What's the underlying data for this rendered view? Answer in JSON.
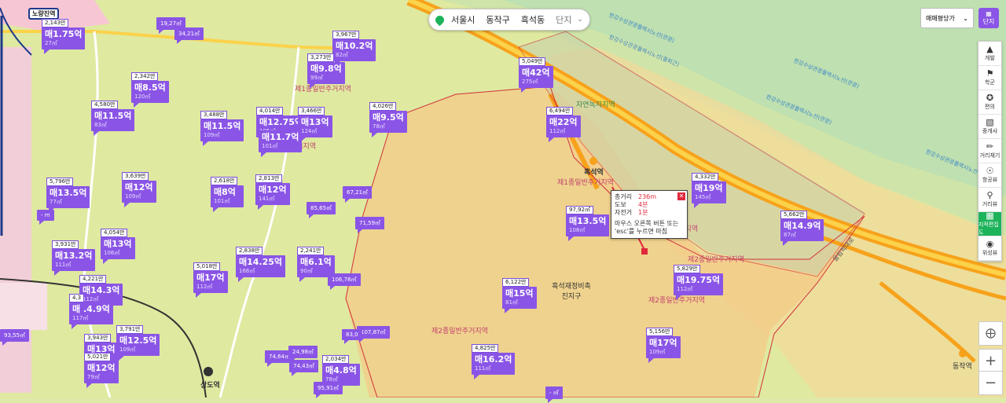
{
  "search_bar": {
    "city": "서울시",
    "district": "동작구",
    "dong": "흑석동",
    "mode": "단지"
  },
  "controls": {
    "select_label": "매매평당가",
    "danji_label": "단지",
    "tools": [
      {
        "label": "개발",
        "icon": "development-icon"
      },
      {
        "label": "학군",
        "icon": "school-icon"
      },
      {
        "label": "편의",
        "icon": "convenience-icon"
      },
      {
        "label": "중개사",
        "icon": "agent-icon"
      },
      {
        "label": "거리재기",
        "icon": "ruler-icon"
      },
      {
        "label": "항공뷰",
        "icon": "aerial-icon"
      },
      {
        "label": "거리뷰",
        "icon": "streetview-icon"
      },
      {
        "label": "지적편집도",
        "icon": "cadastral-icon"
      },
      {
        "label": "위성뷰",
        "icon": "satellite-icon"
      }
    ]
  },
  "popup": {
    "rows": [
      {
        "k": "총거리",
        "v": "236m"
      },
      {
        "k": "도보",
        "v": "4분"
      },
      {
        "k": "자전거",
        "v": "1분"
      }
    ],
    "note": "마우스 오른쪽 버튼 또는 'esc'를 누르면 마침",
    "close": "✕"
  },
  "markers": [
    {
      "tag": "2,143만",
      "price": "매1.75억",
      "area": "27㎡"
    },
    {
      "tag": "3,967만",
      "price": "매10.2억",
      "area": "82㎡"
    },
    {
      "tag": "3,273만",
      "price": "매9.8억",
      "area": "99㎡"
    },
    {
      "tag": "5,049만",
      "price": "매42억",
      "area": "275㎡"
    },
    {
      "tag": "2,342만",
      "price": "매8.5억",
      "area": "120㎡"
    },
    {
      "tag": "4,580만",
      "price": "매11.5억",
      "area": "83㎡"
    },
    {
      "tag": "3,488만",
      "price": "매11.5억",
      "area": "109㎡"
    },
    {
      "tag": "4,014만",
      "price": "매12.75억",
      "area": "105㎡"
    },
    {
      "tag": "3,466만",
      "price": "매13억",
      "area": "124㎡"
    },
    {
      "tag": "4,026만",
      "price": "매9.5억",
      "area": "78㎡"
    },
    {
      "tag": "6,494만",
      "price": "매22억",
      "area": "112㎡"
    },
    {
      "tag": "",
      "price": "매11.7억",
      "area": "101㎡"
    },
    {
      "tag": "5,796만",
      "price": "매13.5억",
      "area": "77㎡"
    },
    {
      "tag": "3,639만",
      "price": "매12억",
      "area": "109㎡"
    },
    {
      "tag": "2,618만",
      "price": "매8억",
      "area": "101㎡"
    },
    {
      "tag": "2,813만",
      "price": "매12억",
      "area": "141㎡"
    },
    {
      "tag": "4,332만",
      "price": "매19억",
      "area": "145㎡"
    },
    {
      "tag": "97,92㎡",
      "price": "매13.5억",
      "area": "108㎡"
    },
    {
      "tag": "5,662만",
      "price": "매14.9억",
      "area": "87㎡"
    },
    {
      "tag": "3,931만",
      "price": "매13.2억",
      "area": "111㎡"
    },
    {
      "tag": "4,054만",
      "price": "매13억",
      "area": "106㎡"
    },
    {
      "tag": "2,838만",
      "price": "매14.25억",
      "area": "166㎡"
    },
    {
      "tag": "2,241만",
      "price": "매6.1억",
      "area": "90㎡"
    },
    {
      "tag": "5,018만",
      "price": "매17억",
      "area": "112㎡"
    },
    {
      "tag": "5,829만",
      "price": "매19.75억",
      "area": "112㎡"
    },
    {
      "tag": "4,221만",
      "price": "매14.3억",
      "area": "112㎡"
    },
    {
      "tag": "4,3",
      "price": "매 .4.9억",
      "area": "117㎡"
    },
    {
      "tag": "6,122만",
      "price": "매15억",
      "area": "81㎡"
    },
    {
      "tag": "3,791만",
      "price": "매12.5억",
      "area": "109㎡"
    },
    {
      "tag": "3,943만",
      "price": "매13억",
      "area": "109㎡"
    },
    {
      "tag": "5,156만",
      "price": "매17억",
      "area": "109㎡"
    },
    {
      "tag": "5,021만",
      "price": "매12억",
      "area": "79㎡"
    },
    {
      "tag": "4,825만",
      "price": "매16.2억",
      "area": "111㎡"
    },
    {
      "tag": "2,034만",
      "price": "매4.8억",
      "area": "78㎡"
    }
  ],
  "area_markers": [
    "19,27㎡",
    "34,21㎡",
    "67,21㎡",
    "85,65㎡",
    "71,59㎡",
    "106,78㎡",
    "107,87㎡",
    "83,0",
    "74,64㎡",
    "24,98㎡",
    "74,43㎡",
    "95,91㎡",
    "93,55㎡",
    "- m",
    "- ㎡"
  ],
  "zone_labels": [
    "제1종일반주거지역",
    "자연녹지지역",
    "제1종일반주거지역",
    "주거지역",
    "제2종일반주거지역",
    "제2종일반주거지역",
    "제2종일반주거지역",
    "주거지역",
    "흑석재정비촉진지구"
  ],
  "river_labels": [
    "한강수상관광플렉시노선(관광)",
    "한강수상관광플렉시노선(출퇴근)",
    "한강수상관광플렉시노선(관광)",
    "한강수상관광플렉시노선(관광)",
    "한강수상관광플렉시노선(관광)"
  ],
  "places": [
    "흑석역",
    "상도역",
    "동작역",
    "노량진역",
    "올림픽대로"
  ]
}
